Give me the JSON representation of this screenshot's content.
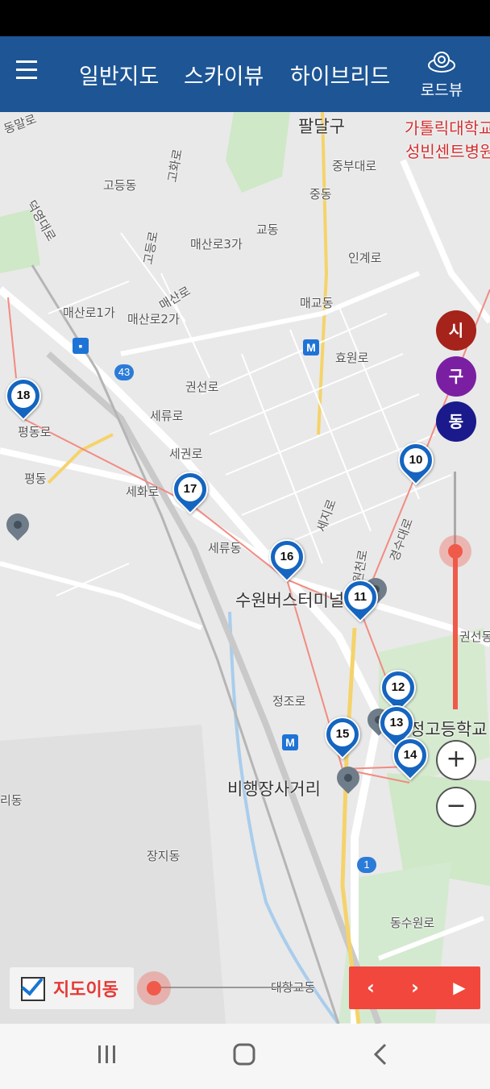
{
  "header": {
    "tabs": [
      {
        "label": "일반지도"
      },
      {
        "label": "스카이뷰"
      },
      {
        "label": "하이브리드"
      }
    ],
    "roadview_label": "로드뷰"
  },
  "map": {
    "labels": [
      "팔달구",
      "가톨릭대학교",
      "성빈센트병원",
      "중부대로",
      "고등동",
      "중동",
      "교동",
      "매산로3가",
      "인계로",
      "매교동",
      "매산로1가",
      "매산로2가",
      "효원로",
      "권선로",
      "세류로",
      "세권로",
      "평동로",
      "평동",
      "세화로",
      "세류동",
      "수원버스터미널",
      "권선동",
      "정조로",
      "비행장사거리",
      "리동",
      "장지동",
      "대항교동",
      "동수원로",
      "경수대로",
      "세지로",
      "수원천로",
      "동말로",
      "덕영대로",
      "고화로",
      "매산로",
      "고등로",
      "정고등학교"
    ],
    "route_badges": [
      "43",
      "1"
    ],
    "metro_icon": "M"
  },
  "markers": [
    "10",
    "11",
    "12",
    "13",
    "14",
    "15",
    "16",
    "17",
    "18"
  ],
  "level_buttons": [
    {
      "label": "시",
      "color": "#a5231a"
    },
    {
      "label": "구",
      "color": "#7b1fa2"
    },
    {
      "label": "동",
      "color": "#1a1a8c"
    }
  ],
  "zoom": {
    "in": "+",
    "out": "−"
  },
  "bottom": {
    "move_label": "지도이동",
    "checked": true
  },
  "controls": {
    "prev": "‹",
    "next": "›",
    "play": "▶"
  },
  "colors": {
    "header": "#1d5595",
    "accent": "#f2473c",
    "marker": "#1565c0"
  }
}
